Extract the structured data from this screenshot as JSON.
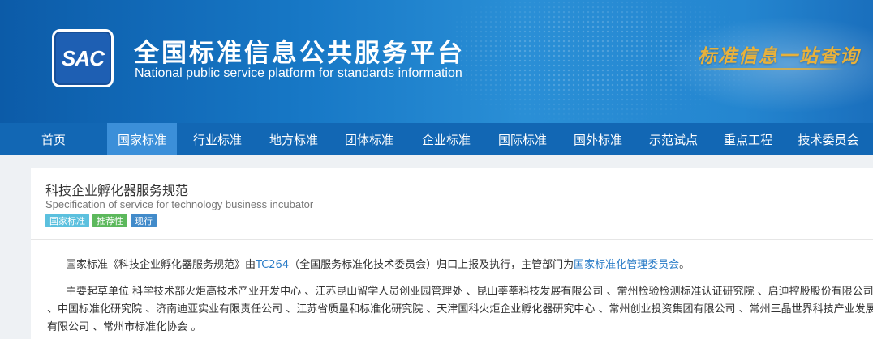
{
  "header": {
    "logo_text": "SAC",
    "title_cn": "全国标准信息公共服务平台",
    "title_en": "National public service platform  for standards information",
    "slogan": "标准信息一站查询",
    "colors": {
      "bg": "#1778c6",
      "slogan": "#e8b13b"
    }
  },
  "nav": {
    "items": [
      {
        "label": "首页"
      },
      {
        "label": "国家标准",
        "active": true
      },
      {
        "label": "行业标准"
      },
      {
        "label": "地方标准"
      },
      {
        "label": "团体标准"
      },
      {
        "label": "企业标准"
      },
      {
        "label": "国际标准"
      },
      {
        "label": "国外标准"
      },
      {
        "label": "示范试点"
      },
      {
        "label": "重点工程"
      },
      {
        "label": "技术委员会"
      }
    ],
    "colors": {
      "bg": "#1267b4",
      "active": "#3b8fd9"
    }
  },
  "standard": {
    "title_cn": "科技企业孵化器服务规范",
    "title_en": "Specification of service for technology business incubator",
    "tags": [
      {
        "label": "国家标准",
        "color": "#5bc0de"
      },
      {
        "label": "推荐性",
        "color": "#5cb85c"
      },
      {
        "label": "现行",
        "color": "#428bca"
      }
    ],
    "summary": {
      "prefix": "国家标准《科技企业孵化器服务规范》由",
      "tc_link": "TC264",
      "middle": "（全国服务标准化技术委员会）归口上报及执行，主管部门为",
      "dept_link": "国家标准化管理委员会",
      "suffix": "。"
    },
    "drafting": {
      "line1": "主要起草单位 科学技术部火炬高技术产业开发中心 、江苏昆山留学人员创业园管理处 、昆山莘莘科技发展有限公司 、常州检验检测标准认证研究院 、启迪控股股份有限公司",
      "line2": "、中国标准化研究院 、济南迪亚实业有限责任公司 、江苏省质量和标准化研究院 、天津国科火炬企业孵化器研究中心 、常州创业投资集团有限公司 、常州三晶世界科技产业发展",
      "line3": "有限公司 、常州市标准化协会 。"
    }
  }
}
